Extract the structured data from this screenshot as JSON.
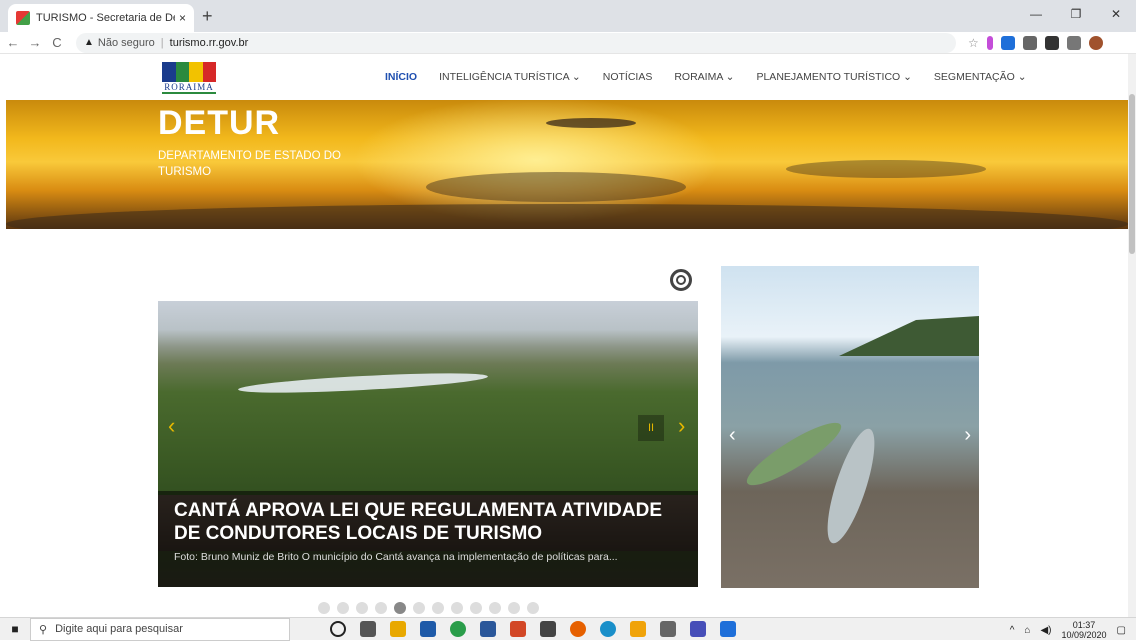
{
  "browser": {
    "tab_title": "TURISMO - Secretaria de Desenv",
    "tab_close": "×",
    "new_tab": "+",
    "url_warning": "Não seguro",
    "url_separator": "|",
    "url": "turismo.rr.gov.br"
  },
  "nav": {
    "logo_text": "RORAIMA",
    "items": [
      {
        "label": "INÍCIO"
      },
      {
        "label": "INTELIGÊNCIA TURÍSTICA ⌄"
      },
      {
        "label": "NOTÍCIAS"
      },
      {
        "label": "RORAIMA ⌄"
      },
      {
        "label": "PLANEJAMENTO TURÍSTICO ⌄"
      },
      {
        "label": "SEGMENTAÇÃO ⌄"
      }
    ]
  },
  "hero": {
    "title": "DETUR",
    "subtitle": "DEPARTAMENTO DE ESTADO DO TURISMO"
  },
  "slider": {
    "headline": "CANTÁ APROVA LEI QUE REGULAMENTA ATIVIDADE DE CONDUTORES LOCAIS DE TURISMO",
    "summary": "Foto: Bruno Muniz de Brito O município do Cantá avança na implementação de políticas para...",
    "prev": "‹",
    "next": "›",
    "pause": "II",
    "dots_total": 12,
    "dots_active_index": 4
  },
  "side_slider": {
    "prev": "‹",
    "next": "›"
  },
  "taskbar": {
    "search_placeholder": "Digite aqui para pesquisar",
    "time": "01:37",
    "date": "10/09/2020"
  },
  "colors": {
    "accent": "#1f4fb0",
    "slider_arrow": "#e6b800"
  }
}
